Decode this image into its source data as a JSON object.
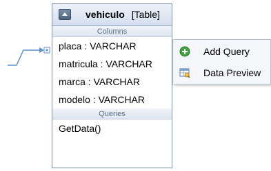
{
  "table": {
    "name": "vehiculo",
    "kind": "[Table]",
    "columns_header": "Columns",
    "columns": [
      "placa : VARCHAR",
      "matricula : VARCHAR",
      "marca : VARCHAR",
      "modelo : VARCHAR"
    ],
    "queries_header": "Queries",
    "queries": [
      "GetData()"
    ]
  },
  "context_menu": {
    "items": [
      {
        "label": "Add Query",
        "icon": "add-icon"
      },
      {
        "label": "Data Preview",
        "icon": "data-preview-icon"
      }
    ]
  },
  "colors": {
    "header_bg": "#d3deee",
    "border": "#7a8fa8",
    "section_text": "#5b6f8a",
    "add_icon": "#3fa33f",
    "connector": "#5a8fd0"
  }
}
